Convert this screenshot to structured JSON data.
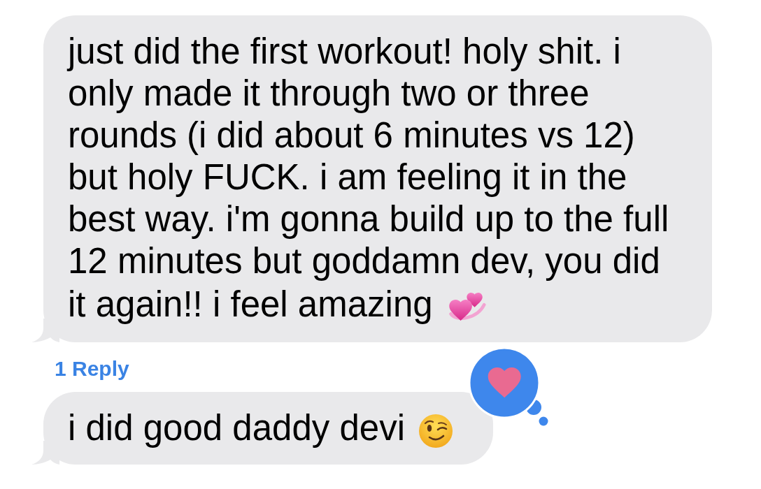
{
  "conversation": {
    "message": {
      "lines": [
        "just did the first workout! holy shit. i",
        "only made it through two or three",
        "rounds (i did about 6 minutes vs 12)",
        "but holy FUCK. i am feeling it in the",
        "best way. i'm gonna build up to the full",
        "12 minutes but goddamn dev, you did",
        "it again!! i feel amazing"
      ]
    },
    "replies_link": "1 Reply",
    "reply": {
      "text": "i did good daddy devi"
    }
  }
}
